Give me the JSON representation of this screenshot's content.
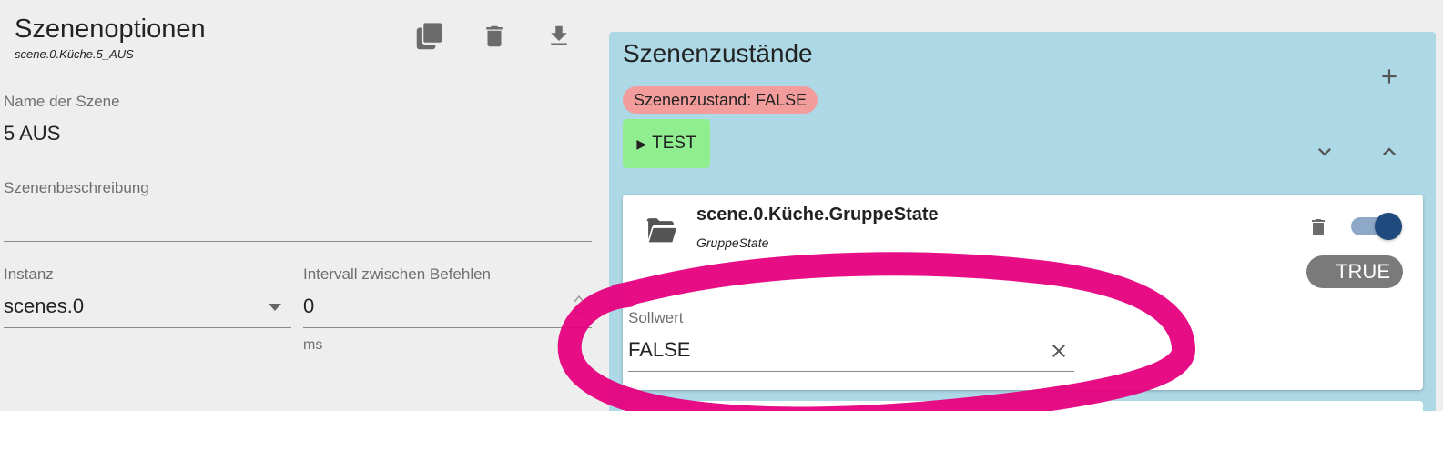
{
  "options": {
    "title": "Szenenoptionen",
    "scene_id": "scene.0.Küche.5_AUS",
    "toolbar": {
      "copy_icon": "copy-icon",
      "delete_icon": "trash-icon",
      "download_icon": "download-icon"
    },
    "name_label": "Name der Szene",
    "name_value": "5 AUS",
    "description_label": "Szenenbeschreibung",
    "description_value": "",
    "instance_label": "Instanz",
    "instance_value": "scenes.0",
    "interval_label": "Intervall zwischen Befehlen",
    "interval_value": "0",
    "interval_unit": "ms"
  },
  "states": {
    "title": "Szenenzustände",
    "badge": "Szenenzustand: FALSE",
    "test_label": "TEST",
    "member": {
      "id": "scene.0.Küche.GruppeState",
      "name": "GruppeState",
      "toggle_on": true,
      "value_button": "TRUE",
      "setpoint_label": "Sollwert",
      "setpoint_value": "FALSE"
    }
  },
  "colors": {
    "states_bg": "#add8e6",
    "badge_bg": "#f39c9c",
    "test_bg": "#90ee90",
    "toggle_knob": "#1e4a7e",
    "annotation": "#e6007e"
  }
}
